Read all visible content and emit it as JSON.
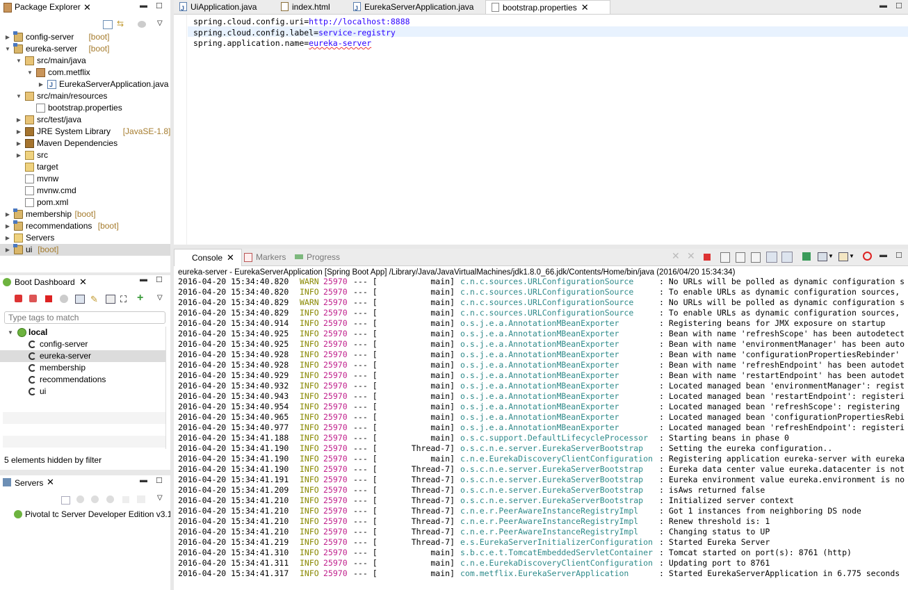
{
  "package_explorer": {
    "title": "Package Explorer",
    "items": [
      {
        "label": "config-server",
        "deco": "[boot]",
        "indent": 0,
        "arrow": "▶",
        "icon": "proj"
      },
      {
        "label": "eureka-server",
        "deco": "[boot]",
        "indent": 0,
        "arrow": "▼",
        "icon": "proj"
      },
      {
        "label": "src/main/java",
        "deco": "",
        "indent": 1,
        "arrow": "▼",
        "icon": "srcf"
      },
      {
        "label": "com.metflix",
        "deco": "",
        "indent": 2,
        "arrow": "▼",
        "icon": "pkg"
      },
      {
        "label": "EurekaServerApplication.java",
        "deco": "",
        "indent": 3,
        "arrow": "▶",
        "icon": "jfile"
      },
      {
        "label": "src/main/resources",
        "deco": "",
        "indent": 1,
        "arrow": "▼",
        "icon": "srcf"
      },
      {
        "label": "bootstrap.properties",
        "deco": "",
        "indent": 2,
        "arrow": "",
        "icon": "file"
      },
      {
        "label": "src/test/java",
        "deco": "",
        "indent": 1,
        "arrow": "▶",
        "icon": "srcf"
      },
      {
        "label": "JRE System Library",
        "deco": "[JavaSE-1.8]",
        "indent": 1,
        "arrow": "▶",
        "icon": "lib"
      },
      {
        "label": "Maven Dependencies",
        "deco": "",
        "indent": 1,
        "arrow": "▶",
        "icon": "lib"
      },
      {
        "label": "src",
        "deco": "",
        "indent": 1,
        "arrow": "▶",
        "icon": "fold"
      },
      {
        "label": "target",
        "deco": "",
        "indent": 1,
        "arrow": "",
        "icon": "fold"
      },
      {
        "label": "mvnw",
        "deco": "",
        "indent": 1,
        "arrow": "",
        "icon": "file"
      },
      {
        "label": "mvnw.cmd",
        "deco": "",
        "indent": 1,
        "arrow": "",
        "icon": "file"
      },
      {
        "label": "pom.xml",
        "deco": "",
        "indent": 1,
        "arrow": "",
        "icon": "file"
      },
      {
        "label": "membership",
        "deco": "[boot]",
        "indent": 0,
        "arrow": "▶",
        "icon": "proj"
      },
      {
        "label": "recommendations",
        "deco": "[boot]",
        "indent": 0,
        "arrow": "▶",
        "icon": "proj"
      },
      {
        "label": "Servers",
        "deco": "",
        "indent": 0,
        "arrow": "▶",
        "icon": "fold"
      },
      {
        "label": "ui",
        "deco": "[boot]",
        "indent": 0,
        "arrow": "▶",
        "icon": "proj",
        "selected": true
      }
    ]
  },
  "editor": {
    "tabs": [
      {
        "label": "UiApplication.java",
        "icon": "java"
      },
      {
        "label": "index.html",
        "icon": "html"
      },
      {
        "label": "EurekaServerApplication.java",
        "icon": "java"
      },
      {
        "label": "bootstrap.properties",
        "icon": "props",
        "active": true
      }
    ],
    "lines": [
      {
        "key": "spring.cloud.config.uri=",
        "value": "http://localhost:8888"
      },
      {
        "key": "spring.cloud.config.label=",
        "value": "service-registry"
      },
      {
        "key": "spring.application.name=",
        "value": "eureka-server"
      }
    ]
  },
  "boot_dashboard": {
    "title": "Boot Dashboard",
    "filter_placeholder": "Type tags to match",
    "root": "local",
    "apps": [
      "config-server",
      "eureka-server",
      "membership",
      "recommendations",
      "ui"
    ],
    "selected_app": "eureka-server",
    "hidden_note": "5 elements hidden by filter"
  },
  "servers": {
    "title": "Servers",
    "items": [
      "Pivotal tc Server Developer Edition v3.1"
    ]
  },
  "console": {
    "tabs": [
      "Console",
      "Markers",
      "Progress"
    ],
    "header": "eureka-server - EurekaServerApplication [Spring Boot App] /Library/Java/JavaVirtualMachines/jdk1.8.0_66.jdk/Contents/Home/bin/java (2016/04/20 15:34:34)",
    "lines": [
      {
        "ts": "2016-04-20 15:34:40.820",
        "lvl": "WARN",
        "pid": "25970",
        "thr": "main]",
        "lg": "c.n.c.sources.URLConfigurationSource",
        "msg": ": No URLs will be polled as dynamic configuration s"
      },
      {
        "ts": "2016-04-20 15:34:40.820",
        "lvl": "INFO",
        "pid": "25970",
        "thr": "main]",
        "lg": "c.n.c.sources.URLConfigurationSource",
        "msg": ": To enable URLs as dynamic configuration sources,"
      },
      {
        "ts": "2016-04-20 15:34:40.829",
        "lvl": "WARN",
        "pid": "25970",
        "thr": "main]",
        "lg": "c.n.c.sources.URLConfigurationSource",
        "msg": ": No URLs will be polled as dynamic configuration s"
      },
      {
        "ts": "2016-04-20 15:34:40.829",
        "lvl": "INFO",
        "pid": "25970",
        "thr": "main]",
        "lg": "c.n.c.sources.URLConfigurationSource",
        "msg": ": To enable URLs as dynamic configuration sources,"
      },
      {
        "ts": "2016-04-20 15:34:40.914",
        "lvl": "INFO",
        "pid": "25970",
        "thr": "main]",
        "lg": "o.s.j.e.a.AnnotationMBeanExporter",
        "msg": ": Registering beans for JMX exposure on startup"
      },
      {
        "ts": "2016-04-20 15:34:40.925",
        "lvl": "INFO",
        "pid": "25970",
        "thr": "main]",
        "lg": "o.s.j.e.a.AnnotationMBeanExporter",
        "msg": ": Bean with name 'refreshScope' has been autodetect"
      },
      {
        "ts": "2016-04-20 15:34:40.925",
        "lvl": "INFO",
        "pid": "25970",
        "thr": "main]",
        "lg": "o.s.j.e.a.AnnotationMBeanExporter",
        "msg": ": Bean with name 'environmentManager' has been auto"
      },
      {
        "ts": "2016-04-20 15:34:40.928",
        "lvl": "INFO",
        "pid": "25970",
        "thr": "main]",
        "lg": "o.s.j.e.a.AnnotationMBeanExporter",
        "msg": ": Bean with name 'configurationPropertiesRebinder'"
      },
      {
        "ts": "2016-04-20 15:34:40.928",
        "lvl": "INFO",
        "pid": "25970",
        "thr": "main]",
        "lg": "o.s.j.e.a.AnnotationMBeanExporter",
        "msg": ": Bean with name 'refreshEndpoint' has been autodet"
      },
      {
        "ts": "2016-04-20 15:34:40.929",
        "lvl": "INFO",
        "pid": "25970",
        "thr": "main]",
        "lg": "o.s.j.e.a.AnnotationMBeanExporter",
        "msg": ": Bean with name 'restartEndpoint' has been autodet"
      },
      {
        "ts": "2016-04-20 15:34:40.932",
        "lvl": "INFO",
        "pid": "25970",
        "thr": "main]",
        "lg": "o.s.j.e.a.AnnotationMBeanExporter",
        "msg": ": Located managed bean 'environmentManager': regist"
      },
      {
        "ts": "2016-04-20 15:34:40.943",
        "lvl": "INFO",
        "pid": "25970",
        "thr": "main]",
        "lg": "o.s.j.e.a.AnnotationMBeanExporter",
        "msg": ": Located managed bean 'restartEndpoint': registeri"
      },
      {
        "ts": "2016-04-20 15:34:40.954",
        "lvl": "INFO",
        "pid": "25970",
        "thr": "main]",
        "lg": "o.s.j.e.a.AnnotationMBeanExporter",
        "msg": ": Located managed bean 'refreshScope': registering"
      },
      {
        "ts": "2016-04-20 15:34:40.965",
        "lvl": "INFO",
        "pid": "25970",
        "thr": "main]",
        "lg": "o.s.j.e.a.AnnotationMBeanExporter",
        "msg": ": Located managed bean 'configurationPropertiesRebi"
      },
      {
        "ts": "2016-04-20 15:34:40.977",
        "lvl": "INFO",
        "pid": "25970",
        "thr": "main]",
        "lg": "o.s.j.e.a.AnnotationMBeanExporter",
        "msg": ": Located managed bean 'refreshEndpoint': registeri"
      },
      {
        "ts": "2016-04-20 15:34:41.188",
        "lvl": "INFO",
        "pid": "25970",
        "thr": "main]",
        "lg": "o.s.c.support.DefaultLifecycleProcessor",
        "msg": ": Starting beans in phase 0"
      },
      {
        "ts": "2016-04-20 15:34:41.190",
        "lvl": "INFO",
        "pid": "25970",
        "thr": "Thread-7]",
        "lg": "o.s.c.n.e.server.EurekaServerBootstrap",
        "msg": ": Setting the eureka configuration.."
      },
      {
        "ts": "2016-04-20 15:34:41.190",
        "lvl": "INFO",
        "pid": "25970",
        "thr": "main]",
        "lg": "c.n.e.EurekaDiscoveryClientConfiguration",
        "msg": ": Registering application eureka-server with eureka"
      },
      {
        "ts": "2016-04-20 15:34:41.190",
        "lvl": "INFO",
        "pid": "25970",
        "thr": "Thread-7]",
        "lg": "o.s.c.n.e.server.EurekaServerBootstrap",
        "msg": ": Eureka data center value eureka.datacenter is not"
      },
      {
        "ts": "2016-04-20 15:34:41.191",
        "lvl": "INFO",
        "pid": "25970",
        "thr": "Thread-7]",
        "lg": "o.s.c.n.e.server.EurekaServerBootstrap",
        "msg": ": Eureka environment value eureka.environment is no"
      },
      {
        "ts": "2016-04-20 15:34:41.209",
        "lvl": "INFO",
        "pid": "25970",
        "thr": "Thread-7]",
        "lg": "o.s.c.n.e.server.EurekaServerBootstrap",
        "msg": ": isAws returned false"
      },
      {
        "ts": "2016-04-20 15:34:41.210",
        "lvl": "INFO",
        "pid": "25970",
        "thr": "Thread-7]",
        "lg": "o.s.c.n.e.server.EurekaServerBootstrap",
        "msg": ": Initialized server context"
      },
      {
        "ts": "2016-04-20 15:34:41.210",
        "lvl": "INFO",
        "pid": "25970",
        "thr": "Thread-7]",
        "lg": "c.n.e.r.PeerAwareInstanceRegistryImpl",
        "msg": ": Got 1 instances from neighboring DS node"
      },
      {
        "ts": "2016-04-20 15:34:41.210",
        "lvl": "INFO",
        "pid": "25970",
        "thr": "Thread-7]",
        "lg": "c.n.e.r.PeerAwareInstanceRegistryImpl",
        "msg": ": Renew threshold is: 1"
      },
      {
        "ts": "2016-04-20 15:34:41.210",
        "lvl": "INFO",
        "pid": "25970",
        "thr": "Thread-7]",
        "lg": "c.n.e.r.PeerAwareInstanceRegistryImpl",
        "msg": ": Changing status to UP"
      },
      {
        "ts": "2016-04-20 15:34:41.219",
        "lvl": "INFO",
        "pid": "25970",
        "thr": "Thread-7]",
        "lg": "e.s.EurekaServerInitializerConfiguration",
        "msg": ": Started Eureka Server"
      },
      {
        "ts": "2016-04-20 15:34:41.310",
        "lvl": "INFO",
        "pid": "25970",
        "thr": "main]",
        "lg": "s.b.c.e.t.TomcatEmbeddedServletContainer",
        "msg": ": Tomcat started on port(s): 8761 (http)"
      },
      {
        "ts": "2016-04-20 15:34:41.311",
        "lvl": "INFO",
        "pid": "25970",
        "thr": "main]",
        "lg": "c.n.e.EurekaDiscoveryClientConfiguration",
        "msg": ": Updating port to 8761"
      },
      {
        "ts": "2016-04-20 15:34:41.317",
        "lvl": "INFO",
        "pid": "25970",
        "thr": "main]",
        "lg": "com.metflix.EurekaServerApplication",
        "msg": ": Started EurekaServerApplication in 6.775 seconds"
      }
    ]
  }
}
